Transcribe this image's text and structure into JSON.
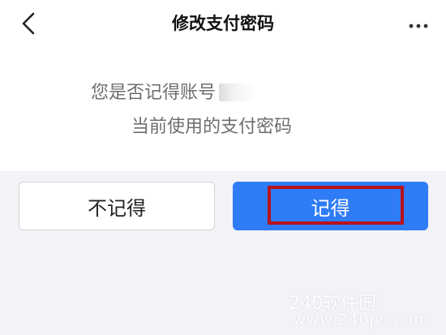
{
  "nav": {
    "title": "修改支付密码",
    "back_icon": "chevron-left-icon",
    "more_icon": "more-horizontal-icon"
  },
  "question": {
    "line1": "您是否记得账号",
    "line2": "当前使用的支付密码"
  },
  "buttons": {
    "forgot_label": "不记得",
    "remember_label": "记得"
  },
  "watermark": {
    "brand": "240软件园",
    "url": "www.240ps.com"
  },
  "colors": {
    "primary": "#2f7cf6",
    "highlight": "#b8121b",
    "page_background": "#f2f2f7"
  }
}
